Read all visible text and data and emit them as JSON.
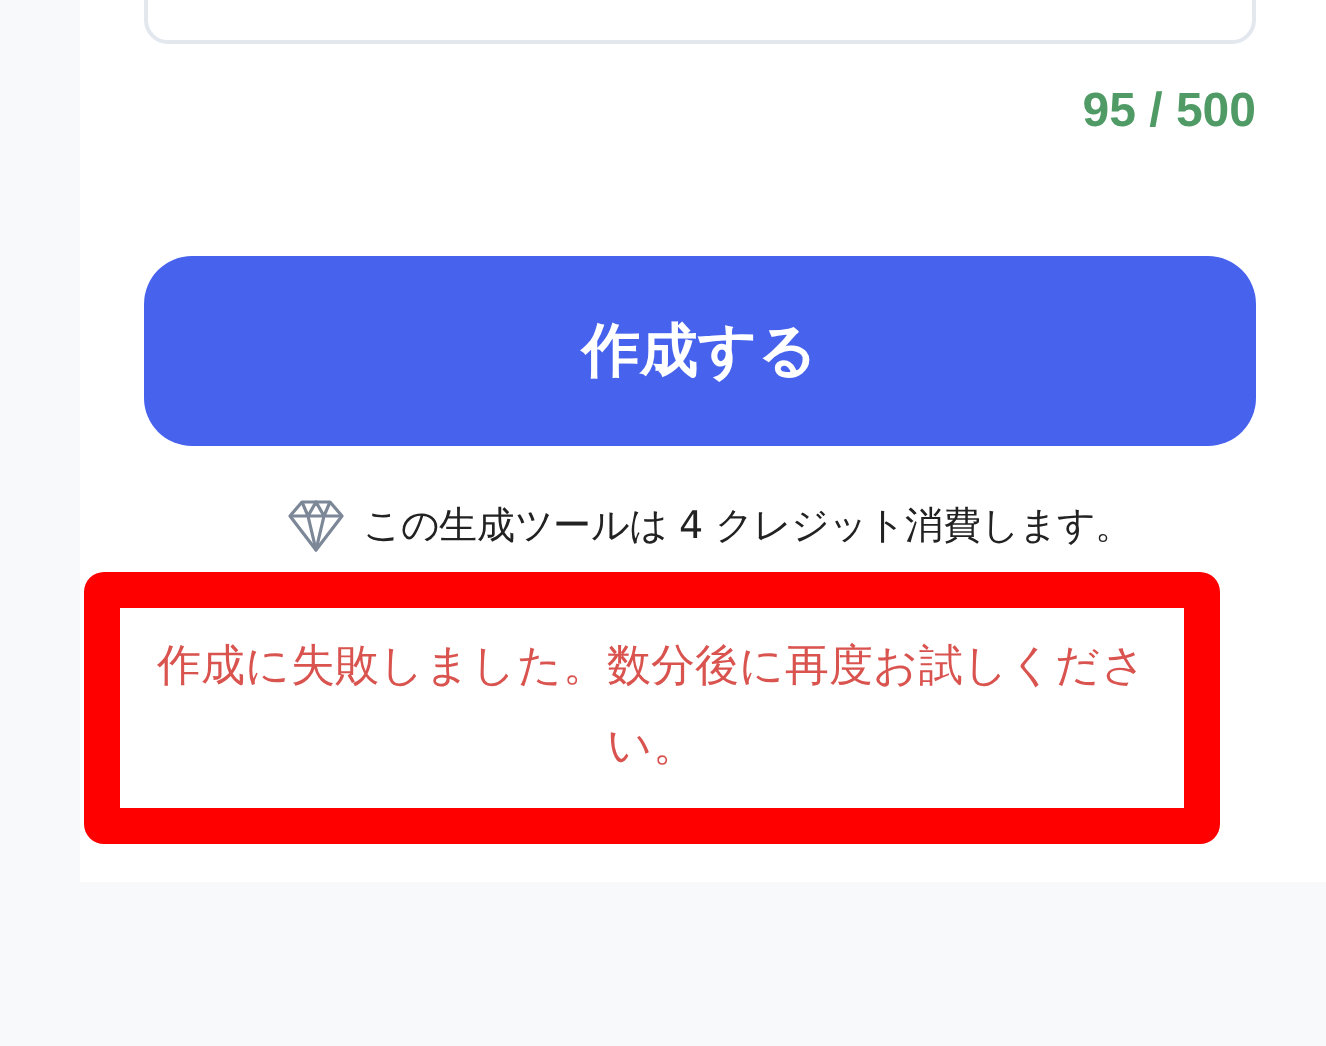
{
  "char_counter": "95 / 500",
  "submit_button": {
    "label": "作成する"
  },
  "credit_note": "この生成ツールは 4 クレジット消費します。",
  "error_message": "作成に失敗しました。数分後に再度お試しください。"
}
